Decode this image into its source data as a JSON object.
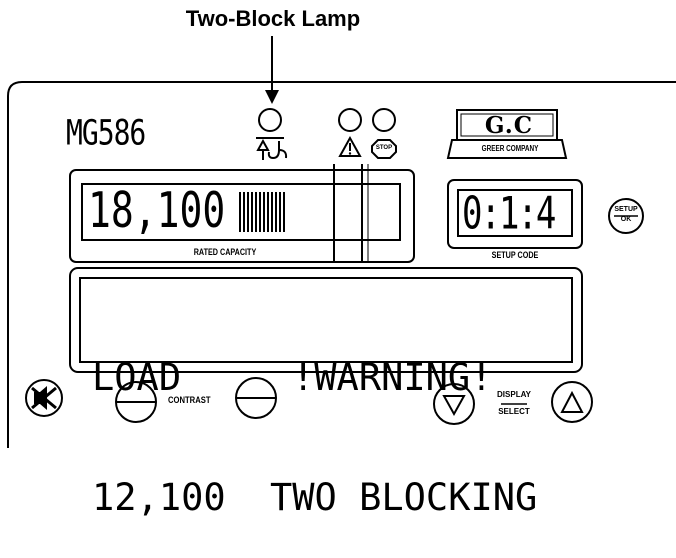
{
  "callout": {
    "title": "Two-Block Lamp"
  },
  "panel": {
    "model": "MG586",
    "logo_letters": "G.C",
    "logo_company": "GREER COMPANY",
    "stop_label": "STOP"
  },
  "capacity_display": {
    "value": "18,100",
    "bargraph_fraction": 0.31,
    "label": "RATED CAPACITY"
  },
  "setup_display": {
    "value": "0:1:4",
    "label": "SETUP CODE"
  },
  "setup_button": {
    "top": "SETUP",
    "bottom": "OK"
  },
  "main_display": {
    "line1_left": "LOAD",
    "line1_right": "!WARNING!",
    "line2_left": "12,100",
    "line2_right": "TWO BLOCKING"
  },
  "controls": {
    "contrast_label": "CONTRAST",
    "display_select_top": "DISPLAY",
    "display_select_bottom": "SELECT"
  }
}
